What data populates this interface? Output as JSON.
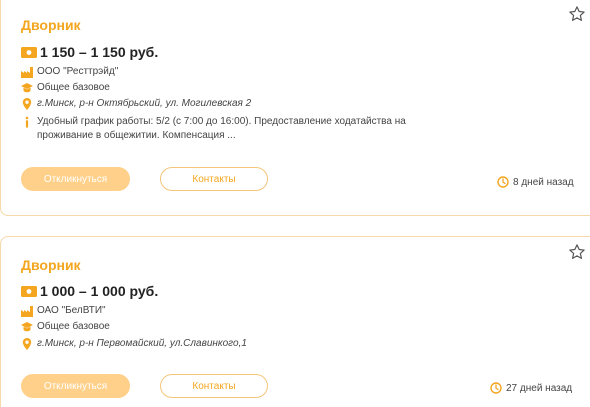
{
  "vacancies": [
    {
      "title": "Дворник",
      "salary": "1 150 – 1 150 руб.",
      "company": "ООО \"Ресттрэйд\"",
      "education": "Общее базовое",
      "address": "г.Минск, р-н Октябрьский, ул. Могилевская 2",
      "description": "Удобный график работы: 5/2 (с 7:00 до 16:00). Предоставление ходатайства на проживание в общежитии. Компенсация ...",
      "apply_label": "Откликнуться",
      "contacts_label": "Контакты",
      "posted": "8 дней назад"
    },
    {
      "title": "Дворник",
      "salary": "1 000 – 1 000 руб.",
      "company": "ОАО \"БелВТИ\"",
      "education": "Общее базовое",
      "address": "г.Минск, р-н Первомайский, ул.Славинкого,1",
      "apply_label": "Откликнуться",
      "contacts_label": "Контакты",
      "posted": "27 дней назад"
    }
  ],
  "icons": {
    "favorite": "star-outline-icon",
    "salary": "money-icon",
    "company": "factory-icon",
    "education": "graduation-cap-icon",
    "address": "map-pin-icon",
    "description": "info-icon",
    "posted": "clock-icon"
  },
  "colors": {
    "accent": "#f4a620",
    "apply_button_bg": "#ffd08a",
    "card_border": "#f5d9a8"
  }
}
